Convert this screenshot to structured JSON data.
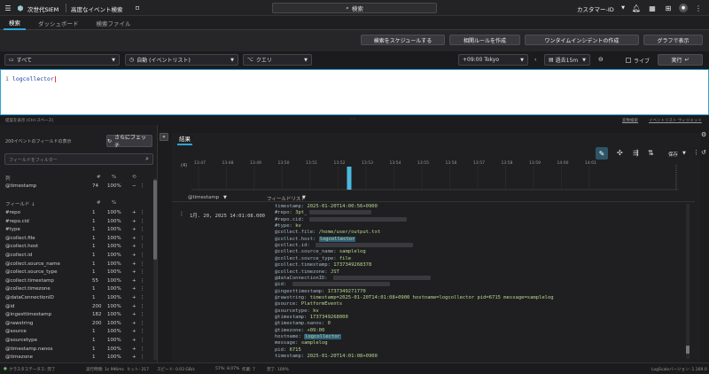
{
  "topbar": {
    "app_title": "次世代SIEM",
    "page_title": "高度なイベント検索",
    "search_label": "検索",
    "customer": "カスタマー-ID"
  },
  "tabs": [
    {
      "label": "検索"
    },
    {
      "label": "ダッシュボード"
    },
    {
      "label": "検索ファイル"
    }
  ],
  "actions": {
    "schedule": "検索をスケジュールする",
    "correlation": "相関ルールを作成",
    "oneoff": "ワンタイムインシデントの作成",
    "graph": "グラフで表示"
  },
  "query": {
    "repo": "すべて",
    "mode": "自動 (イベントリスト)",
    "type": "クエリ",
    "timezone": "+09:00 Tokyo",
    "range": "過去15m",
    "live": "ライブ",
    "run": "実行",
    "line_no": "1",
    "text": "logcollector"
  },
  "strip": {
    "left": "提案を表示 (Ctrl-スペース)",
    "history": "変数検索",
    "events": "イベントリスト ウィジェット"
  },
  "fields": {
    "header": "200イベントのフィールドの表示",
    "fetch": "さらにフェッチ",
    "filter_placeholder": "フィールドをフィルター",
    "col_column": "列",
    "col_count": "#",
    "col_pct": "%",
    "pinned": [
      {
        "name": "@timestamp",
        "count": "74",
        "pct": "100%"
      }
    ],
    "section_label": "フィールド ↓",
    "list": [
      {
        "name": "#repo",
        "count": "1",
        "pct": "100%"
      },
      {
        "name": "#repo.cid",
        "count": "1",
        "pct": "100%"
      },
      {
        "name": "#type",
        "count": "1",
        "pct": "100%"
      },
      {
        "name": "@collect.file",
        "count": "1",
        "pct": "100%"
      },
      {
        "name": "@collect.host",
        "count": "1",
        "pct": "100%"
      },
      {
        "name": "@collect.id",
        "count": "1",
        "pct": "100%"
      },
      {
        "name": "@collect.source_name",
        "count": "1",
        "pct": "100%"
      },
      {
        "name": "@collect.source_type",
        "count": "1",
        "pct": "100%"
      },
      {
        "name": "@collect.timestamp",
        "count": "55",
        "pct": "100%"
      },
      {
        "name": "@collect.timezone",
        "count": "1",
        "pct": "100%"
      },
      {
        "name": "@dataConnectionID",
        "count": "1",
        "pct": "100%"
      },
      {
        "name": "@id",
        "count": "200",
        "pct": "100%"
      },
      {
        "name": "@ingesttimestamp",
        "count": "182",
        "pct": "100%"
      },
      {
        "name": "@rawstring",
        "count": "200",
        "pct": "100%"
      },
      {
        "name": "@source",
        "count": "1",
        "pct": "100%"
      },
      {
        "name": "@sourcetype",
        "count": "1",
        "pct": "100%"
      },
      {
        "name": "@timestamp.nanos",
        "count": "1",
        "pct": "100%"
      },
      {
        "name": "@timezone",
        "count": "1",
        "pct": "100%"
      }
    ]
  },
  "results": {
    "tab": "結果",
    "save": "保存",
    "histogram_y": "(4)",
    "ticks": [
      "13:47",
      "13:48",
      "13:49",
      "13:50",
      "13:51",
      "13:52",
      "13:53",
      "13:54",
      "13:55",
      "13:56",
      "13:57",
      "13:58",
      "13:59",
      "14:00",
      "14:01"
    ],
    "col_timestamp": "@timestamp",
    "col_fields": "フィールドリスト",
    "event_time": "1月. 20, 2025 14:01:08.000",
    "lines": [
      {
        "k": "timestamp:",
        "v": "2025-01-20T14:00:56+0900"
      },
      {
        "k": "#repo:",
        "v": "3pt_"
      },
      {
        "k": "#repo.cid:",
        "v": ""
      },
      {
        "k": "#type:",
        "v": "kv"
      },
      {
        "k": "@collect.file:",
        "v": "/home/user/output.txt"
      },
      {
        "k": "@collect.host:",
        "v": "logcollector"
      },
      {
        "k": "@collect.id:",
        "v": ""
      },
      {
        "k": "@collect.source_name:",
        "v": "samplelog"
      },
      {
        "k": "@collect.source_type:",
        "v": "file"
      },
      {
        "k": "@collect.timestamp:",
        "v": "1737349268378"
      },
      {
        "k": "@collect.timezone:",
        "v": "JST"
      },
      {
        "k": "@dataConnectionID:",
        "v": ""
      },
      {
        "k": "@id:",
        "v": ""
      },
      {
        "k": "@ingesttimestamp:",
        "v": "1737349271770"
      },
      {
        "k": "@rawstring:",
        "v": "timestamp=2025-01-20T14:01:08+0900 hostname=logcollector pid=6715 message=samplelog"
      },
      {
        "k": "@source:",
        "v": "PlatformEvents"
      },
      {
        "k": "@sourcetype:",
        "v": "kv"
      },
      {
        "k": "@timestamp:",
        "v": "1737349268000"
      },
      {
        "k": "@timestamp.nanos:",
        "v": "0"
      },
      {
        "k": "@timezone:",
        "v": "+09:00"
      },
      {
        "k": "hostname:",
        "v": "logcollector"
      },
      {
        "k": "message:",
        "v": "samplelog"
      },
      {
        "k": "pid:",
        "v": "6715"
      },
      {
        "k": "timestamp:",
        "v": "2025-01-20T14:01:08+0900"
      }
    ]
  },
  "status": {
    "cluster": "クラスタステータス: 完了",
    "exec": "実行時間: 1s 996ms",
    "hits": "ヒット: 217",
    "speed": "スピード: 0.03 GB/s",
    "pct": "57%: 8.07%",
    "work": "作業: 7",
    "done": "完了: 100%",
    "version": "LogScaleバージョン: 1.169.0"
  },
  "colors": {
    "accent": "#2aa6d6",
    "bar": "#4bb8e0"
  },
  "histogram": {
    "bars": [
      {
        "tick_index": 5,
        "fraction": 1.0
      }
    ]
  }
}
